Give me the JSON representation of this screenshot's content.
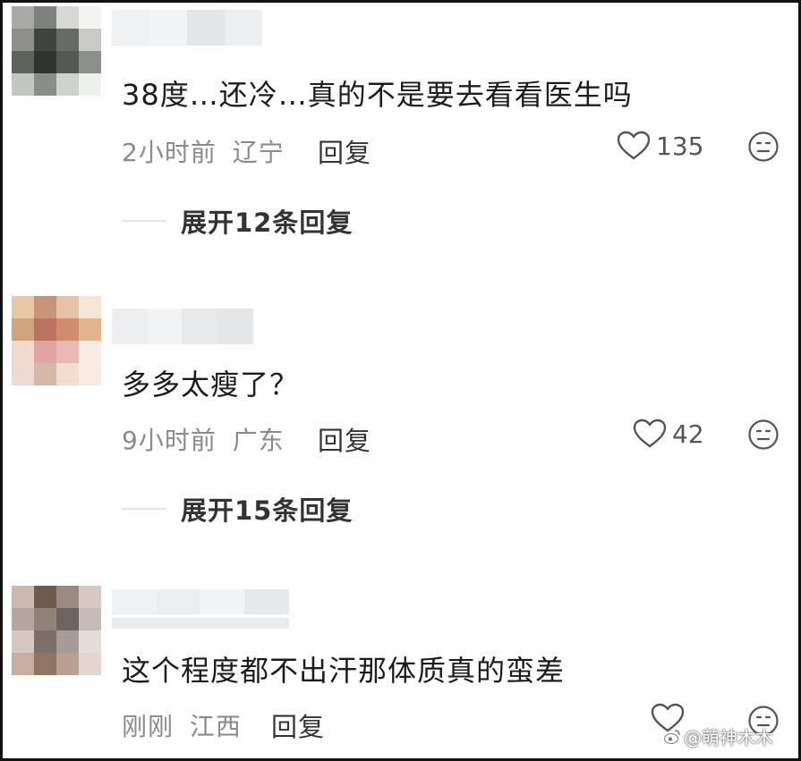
{
  "comments": [
    {
      "text": "38度…还冷…真的不是要去看看医生吗",
      "time": "2小时前",
      "location": "辽宁",
      "reply_label": "回复",
      "like_count": "135",
      "expand_label": "展开12条回复"
    },
    {
      "text": "多多太瘦了？",
      "time": "9小时前",
      "location": "广东",
      "reply_label": "回复",
      "like_count": "42",
      "expand_label": "展开15条回复"
    },
    {
      "text": "这个程度都不出汗那体质真的蛮差",
      "time": "刚刚",
      "location": "江西",
      "reply_label": "回复",
      "like_count": "",
      "expand_label": ""
    }
  ],
  "avatars": [
    [
      "#a9aaa7",
      "#7f817e",
      "#d7d8d6",
      "#f3f3f2",
      "#8e8f8c",
      "#3f443e",
      "#676b65",
      "#c9cac8",
      "#5d625b",
      "#2f352e",
      "#535a51",
      "#8b8f89",
      "#c4c6c3",
      "#8a8e88",
      "#d0d2cf",
      "#eef0ee"
    ],
    [
      "#e8c8a6",
      "#c9957a",
      "#e6c2a6",
      "#f4e6d8",
      "#d2a47e",
      "#b9735e",
      "#cf8e6c",
      "#e3b58f",
      "#f1dbd0",
      "#e2a4a2",
      "#eab8b4",
      "#f8ece6",
      "#eddad0",
      "#d6b8a8",
      "#f2ddd0",
      "#f7ebe2"
    ],
    [
      "#cbb8ae",
      "#6f5a4e",
      "#9c8a80",
      "#d6c9c2",
      "#b4a69f",
      "#8f8279",
      "#6c645f",
      "#c5bcb8",
      "#d5c8c3",
      "#7a6f69",
      "#a69c97",
      "#e4dedb",
      "#c9aea0",
      "#8e7564",
      "#b8a193",
      "#e2d6cf"
    ]
  ],
  "username_colors": [
    "#f1f2f3",
    "#eceeef",
    "#e1e3e5",
    "#f4f5f6"
  ],
  "icons": {
    "like": "heart-outline-icon",
    "emoji": "neutral-face-icon",
    "watermark": "weibo-logo-icon"
  },
  "watermark": {
    "text": "@萌神木木"
  }
}
